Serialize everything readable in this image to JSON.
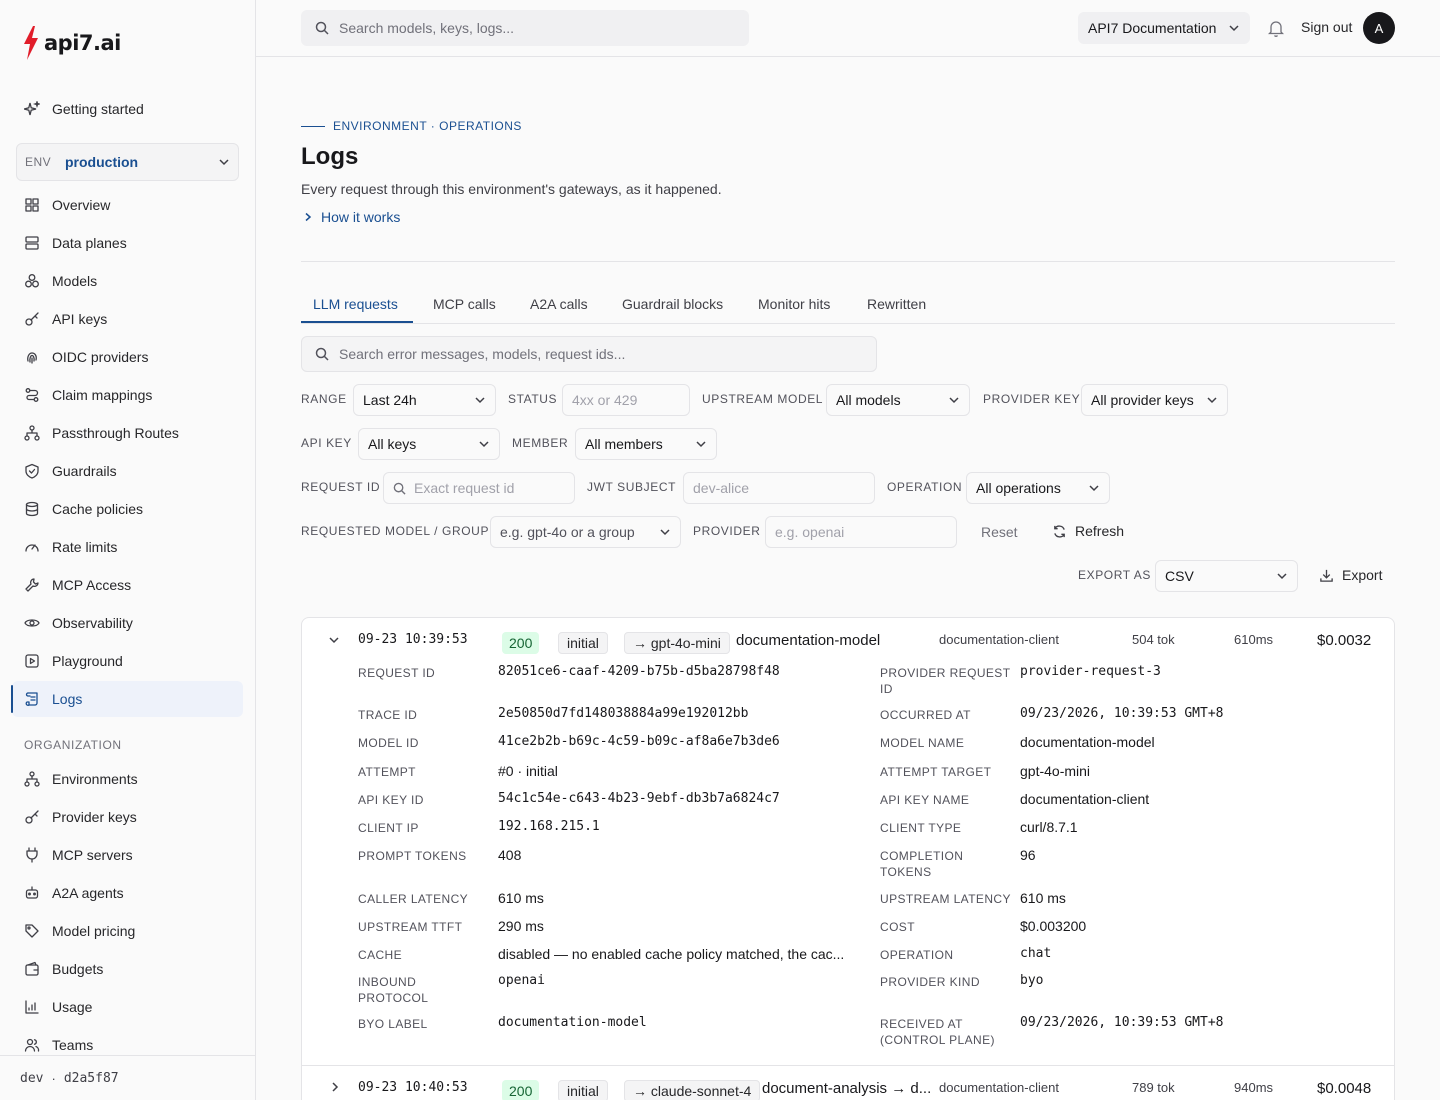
{
  "brand": {
    "logo_text": "api7.ai"
  },
  "sidebar": {
    "getting_started": "Getting started",
    "env": {
      "label": "ENV",
      "value": "production"
    },
    "env_items": [
      {
        "label": "Overview",
        "icon": "grid-icon"
      },
      {
        "label": "Data planes",
        "icon": "server-icon"
      },
      {
        "label": "Models",
        "icon": "cubes-icon"
      },
      {
        "label": "API keys",
        "icon": "key-icon"
      },
      {
        "label": "OIDC providers",
        "icon": "fingerprint-icon"
      },
      {
        "label": "Claim mappings",
        "icon": "route-icon"
      },
      {
        "label": "Passthrough Routes",
        "icon": "network-icon"
      },
      {
        "label": "Guardrails",
        "icon": "shield-icon"
      },
      {
        "label": "Cache policies",
        "icon": "database-icon"
      },
      {
        "label": "Rate limits",
        "icon": "gauge-icon"
      },
      {
        "label": "MCP Access",
        "icon": "wrench-icon"
      },
      {
        "label": "Observability",
        "icon": "eye-icon"
      },
      {
        "label": "Playground",
        "icon": "play-icon"
      },
      {
        "label": "Logs",
        "icon": "scroll-icon"
      }
    ],
    "org_heading": "ORGANIZATION",
    "org_items": [
      {
        "label": "Environments",
        "icon": "network-icon"
      },
      {
        "label": "Provider keys",
        "icon": "key-icon"
      },
      {
        "label": "MCP servers",
        "icon": "plug-icon"
      },
      {
        "label": "A2A agents",
        "icon": "bot-icon"
      },
      {
        "label": "Model pricing",
        "icon": "tag-icon"
      },
      {
        "label": "Budgets",
        "icon": "wallet-icon"
      },
      {
        "label": "Usage",
        "icon": "chart-icon"
      },
      {
        "label": "Teams",
        "icon": "users-icon"
      }
    ],
    "footer": {
      "env": "dev",
      "sep": "·",
      "commit": "d2a5f87"
    }
  },
  "topbar": {
    "search_placeholder": "Search models, keys, logs...",
    "docs": "API7 Documentation",
    "sign_out": "Sign out",
    "avatar": "A"
  },
  "page": {
    "eyebrow": "ENVIRONMENT · OPERATIONS",
    "title": "Logs",
    "description": "Every request through this environment's gateways, as it happened.",
    "how_it_works": "How it works"
  },
  "tabs": [
    "LLM requests",
    "MCP calls",
    "A2A calls",
    "Guardrail blocks",
    "Monitor hits",
    "Rewritten"
  ],
  "filters": {
    "search_placeholder": "Search error messages, models, request ids...",
    "range": {
      "label": "RANGE",
      "value": "Last 24h"
    },
    "status": {
      "label": "STATUS",
      "placeholder": "4xx or 429"
    },
    "upstream_model": {
      "label": "UPSTREAM MODEL",
      "value": "All models"
    },
    "provider_key": {
      "label": "PROVIDER KEY",
      "value": "All provider keys"
    },
    "api_key": {
      "label": "API KEY",
      "value": "All keys"
    },
    "member": {
      "label": "MEMBER",
      "value": "All members"
    },
    "request_id": {
      "label": "REQUEST ID",
      "placeholder": "Exact request id"
    },
    "jwt_subject": {
      "label": "JWT SUBJECT",
      "placeholder": "dev-alice"
    },
    "operation": {
      "label": "OPERATION",
      "value": "All operations"
    },
    "requested_model": {
      "label": "REQUESTED MODEL / GROUP",
      "value": "e.g. gpt-4o or a group"
    },
    "provider": {
      "label": "PROVIDER",
      "placeholder": "e.g. openai"
    },
    "reset": "Reset",
    "refresh": "Refresh",
    "export_as": {
      "label": "EXPORT AS",
      "value": "CSV"
    },
    "export": "Export"
  },
  "logs": [
    {
      "time": "09-23 10:39:53",
      "status": "200",
      "attempt": "initial",
      "target": "→ gpt-4o-mini",
      "model": "documentation-model",
      "client": "documentation-client",
      "tokens": "504 tok",
      "latency": "610ms",
      "cost": "$0.0032",
      "expanded": true,
      "details_left": [
        {
          "key": "REQUEST ID",
          "value": "82051ce6-caaf-4209-b75b-d5ba28798f48",
          "mono": true
        },
        {
          "key": "TRACE ID",
          "value": "2e50850d7fd148038884a99e192012bb",
          "mono": true
        },
        {
          "key": "MODEL ID",
          "value": "41ce2b2b-b69c-4c59-b09c-af8a6e7b3de6",
          "mono": true
        },
        {
          "key": "ATTEMPT",
          "value": "#0 · initial",
          "mono": false
        },
        {
          "key": "API KEY ID",
          "value": "54c1c54e-c643-4b23-9ebf-db3b7a6824c7",
          "mono": true
        },
        {
          "key": "CLIENT IP",
          "value": "192.168.215.1",
          "mono": true
        },
        {
          "key": "PROMPT TOKENS",
          "value": "408",
          "mono": false
        },
        {
          "key": "CALLER LATENCY",
          "value": "610 ms",
          "mono": false
        },
        {
          "key": "UPSTREAM TTFT",
          "value": "290 ms",
          "mono": false
        },
        {
          "key": "CACHE",
          "value": "disabled — no enabled cache policy matched, the cac...",
          "mono": false
        },
        {
          "key": "INBOUND PROTOCOL",
          "value": "openai",
          "mono": true
        },
        {
          "key": "BYO LABEL",
          "value": "documentation-model",
          "mono": true
        }
      ],
      "details_right": [
        {
          "key": "PROVIDER REQUEST ID",
          "value": "provider-request-3",
          "mono": true
        },
        {
          "key": "OCCURRED AT",
          "value": "09/23/2026, 10:39:53 GMT+8",
          "mono": true
        },
        {
          "key": "MODEL NAME",
          "value": "documentation-model",
          "mono": false
        },
        {
          "key": "ATTEMPT TARGET",
          "value": "gpt-4o-mini",
          "mono": false
        },
        {
          "key": "API KEY NAME",
          "value": "documentation-client",
          "mono": false
        },
        {
          "key": "CLIENT TYPE",
          "value": "curl/8.7.1",
          "mono": false
        },
        {
          "key": "COMPLETION TOKENS",
          "value": "96",
          "mono": false
        },
        {
          "key": "UPSTREAM LATENCY",
          "value": "610 ms",
          "mono": false
        },
        {
          "key": "COST",
          "value": "$0.003200",
          "mono": false
        },
        {
          "key": "OPERATION",
          "value": "chat",
          "mono": true
        },
        {
          "key": "PROVIDER KIND",
          "value": "byo",
          "mono": true
        },
        {
          "key": "RECEIVED AT (CONTROL PLANE)",
          "value": "09/23/2026, 10:39:53 GMT+8",
          "mono": true
        }
      ]
    },
    {
      "time": "09-23 10:40:53",
      "status": "200",
      "attempt": "initial",
      "target": "→ claude-sonnet-4",
      "model": "document-analysis → d...",
      "client": "documentation-client",
      "tokens": "789 tok",
      "latency": "940ms",
      "cost": "$0.0048",
      "expanded": false
    }
  ],
  "colors": {
    "accent": "#1a4f91",
    "success_bg": "#dcfce7",
    "success_fg": "#166534",
    "logo_red": "#e11d2a"
  }
}
